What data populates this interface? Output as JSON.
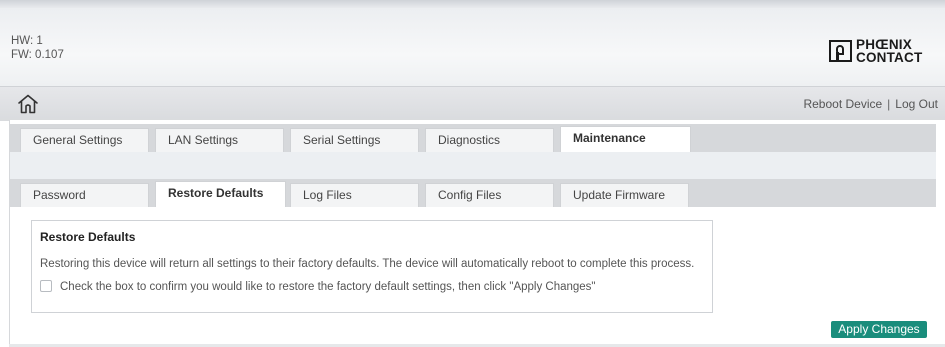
{
  "header": {
    "hw_label": "HW: 1",
    "fw_label": "FW: 0.107",
    "brand_line1": "PHŒNIX",
    "brand_line2": "CONTACT"
  },
  "nav": {
    "home_icon": "home-icon",
    "reboot_label": "Reboot Device",
    "separator": "|",
    "logout_label": "Log Out"
  },
  "main_tabs": [
    {
      "label": "General Settings",
      "active": false
    },
    {
      "label": "LAN Settings",
      "active": false
    },
    {
      "label": "Serial Settings",
      "active": false
    },
    {
      "label": "Diagnostics",
      "active": false
    },
    {
      "label": "Maintenance",
      "active": true
    }
  ],
  "sub_tabs": [
    {
      "label": "Password",
      "active": false
    },
    {
      "label": "Restore Defaults",
      "active": true
    },
    {
      "label": "Log Files",
      "active": false
    },
    {
      "label": "Config Files",
      "active": false
    },
    {
      "label": "Update Firmware",
      "active": false
    }
  ],
  "restore": {
    "title": "Restore Defaults",
    "description": "Restoring this device will return all settings to their factory defaults. The device will automatically reboot to complete this process.",
    "confirm_label": "Check the box to confirm you would like to restore the factory default settings, then click \"Apply Changes\"",
    "confirm_checked": false
  },
  "actions": {
    "apply_label": "Apply Changes"
  },
  "colors": {
    "accent": "#1a8d7c",
    "tab_bar": "#d6d8db",
    "active_tab": "#ffffff"
  }
}
